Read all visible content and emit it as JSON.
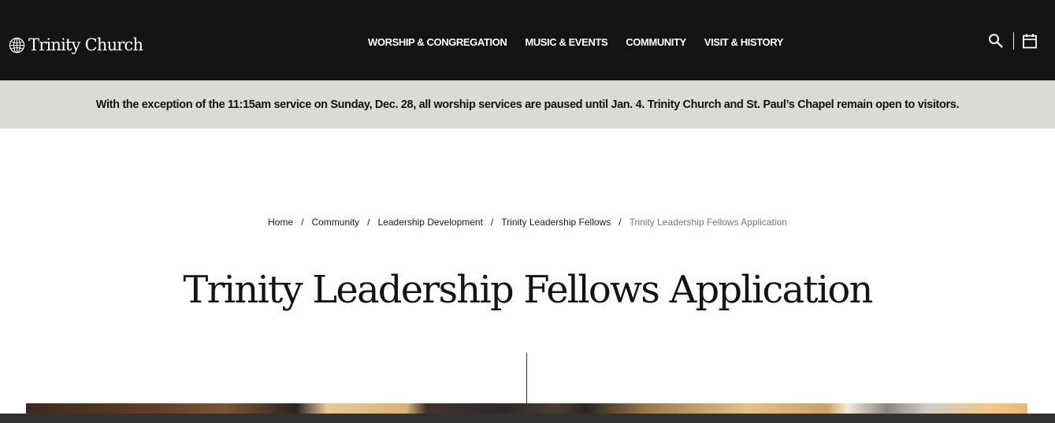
{
  "header": {
    "logo_text": "Trinity Church",
    "nav": [
      {
        "label": "WORSHIP & CONGREGATION"
      },
      {
        "label": "MUSIC & EVENTS"
      },
      {
        "label": "COMMUNITY"
      },
      {
        "label": "VISIT & HISTORY"
      }
    ],
    "icons": [
      "search-icon",
      "calendar-icon"
    ]
  },
  "alert": {
    "text": "With the exception of the 11:15am service on Sunday, Dec. 28, all worship services are paused until Jan. 4. Trinity Church and St. Paul’s Chapel remain open to visitors."
  },
  "breadcrumb": {
    "items": [
      {
        "label": "Home"
      },
      {
        "label": "Community"
      },
      {
        "label": "Leadership Development"
      },
      {
        "label": "Trinity Leadership Fellows"
      }
    ],
    "current": "Trinity Leadership Fellows Application",
    "separator": "/"
  },
  "page": {
    "title": "Trinity Leadership Fellows Application"
  },
  "colors": {
    "header_bg": "#141414",
    "alert_bg": "#dcdad5",
    "text": "#141414",
    "breadcrumb_current": "#777777"
  }
}
